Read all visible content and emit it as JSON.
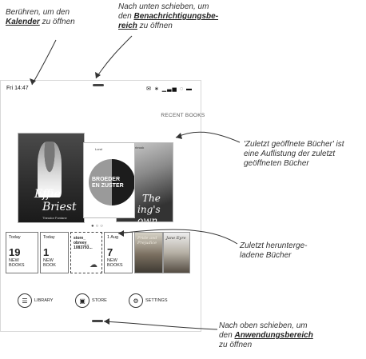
{
  "annotations": {
    "calendar_line1": "Berühren, um den",
    "calendar_link": "Kalender",
    "calendar_line2_rest": " zu öffnen",
    "notif_line1": "Nach unten schieben, um",
    "notif_line2_pre": "den ",
    "notif_link1": "Benachrichtigungsbe-",
    "notif_link2": "reich",
    "notif_line3_rest": " zu öffnen",
    "recent_line1": "'Zuletzt geöffnete Bücher' ist",
    "recent_line2": "eine Auflistung der zuletzt",
    "recent_line3": "geöffneten Bücher",
    "downloaded_line1": "Zuletzt herunterge-",
    "downloaded_line2": "ladene Bücher",
    "apps_line1": "Nach oben schieben, um",
    "apps_line2_pre": "den ",
    "apps_link": "Anwendungsbereich",
    "apps_line3": "zu öffnen"
  },
  "status_bar": {
    "time": "Fri 14:47",
    "icons": [
      "envelope-icon",
      "bluetooth-icon",
      "signal-icon",
      "wifi-icon",
      "battery-icon"
    ]
  },
  "recent_books": {
    "title": "RECENT BOOKS",
    "covers": [
      {
        "title_line1": "Effie",
        "title_line2": "Briest",
        "author": "Theodor Fontane"
      },
      {
        "top": "Lund",
        "title_line1": "BROEDER",
        "title_line2": "EN ZUSTER"
      },
      {
        "top": "Pembrook",
        "title_line1": "The",
        "title_line2": "ing's own"
      }
    ]
  },
  "tiles": [
    {
      "header": "Today",
      "number": "19",
      "label_line1": "NEW",
      "label_line2": "BOOKS"
    },
    {
      "header": "Today",
      "number": "1",
      "label_line1": "NEW",
      "label_line2": "BOOK"
    },
    {
      "label_line1": "store_",
      "label_line2": "obreey_",
      "label_line3": "1083793..."
    },
    {
      "header": "1 Aug",
      "number": "7",
      "label_line1": "NEW",
      "label_line2": "BOOKS"
    }
  ],
  "thumbs": [
    {
      "title": "Pride and Prejudice"
    },
    {
      "title": "Jane Eyre"
    }
  ],
  "nav": {
    "library": "LIBRARY",
    "store": "STORE",
    "settings": "SETTINGS"
  }
}
